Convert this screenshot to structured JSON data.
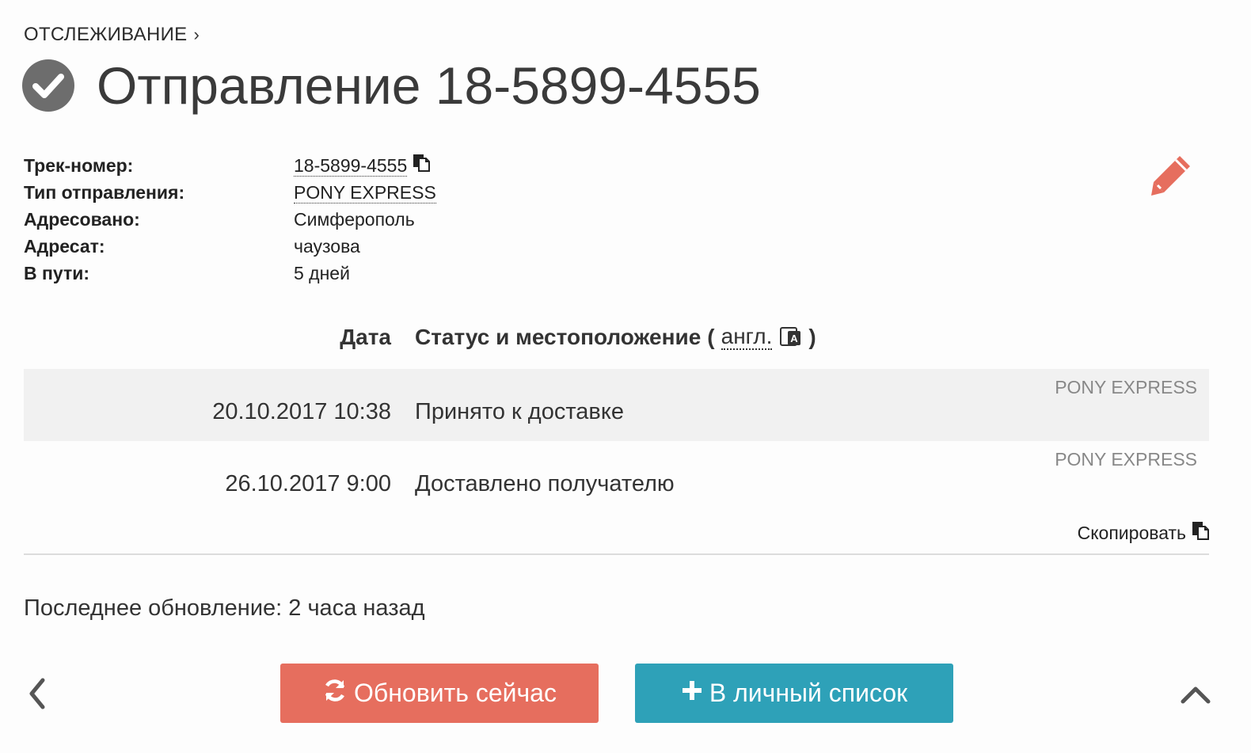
{
  "breadcrumb": {
    "label": "ОТСЛЕЖИВАНИЕ",
    "chevron": "›"
  },
  "header": {
    "title": "Отправление 18-5899-4555",
    "status_icon": "check-circle-icon"
  },
  "info": {
    "track_label": "Трек-номер:",
    "track_value": "18-5899-4555",
    "type_label": "Тип отправления:",
    "type_value": "PONY EXPRESS",
    "addressed_label": "Адресовано:",
    "addressed_value": "Симферополь",
    "recipient_label": "Адресат:",
    "recipient_value": "чаузова",
    "transit_label": "В пути:",
    "transit_value": "5 дней"
  },
  "table": {
    "date_header": "Дата",
    "status_header": "Статус и местоположение",
    "paren_open": "(",
    "lang_link": "англ.",
    "paren_close": ")",
    "rows": [
      {
        "carrier": "PONY EXPRESS",
        "date": "20.10.2017 10:38",
        "status": "Принято к доставке"
      },
      {
        "carrier": "PONY EXPRESS",
        "date": "26.10.2017 9:00",
        "status": "Доставлено получателю"
      }
    ],
    "copy_label": "Скопировать"
  },
  "footer": {
    "last_update": "Последнее обновление: 2 часа назад",
    "refresh_button": "Обновить сейчас",
    "add_button": "В личный список"
  },
  "colors": {
    "accent_red": "#e66e5e",
    "accent_teal": "#2ea1b8",
    "edit_icon": "#e66e5e"
  }
}
